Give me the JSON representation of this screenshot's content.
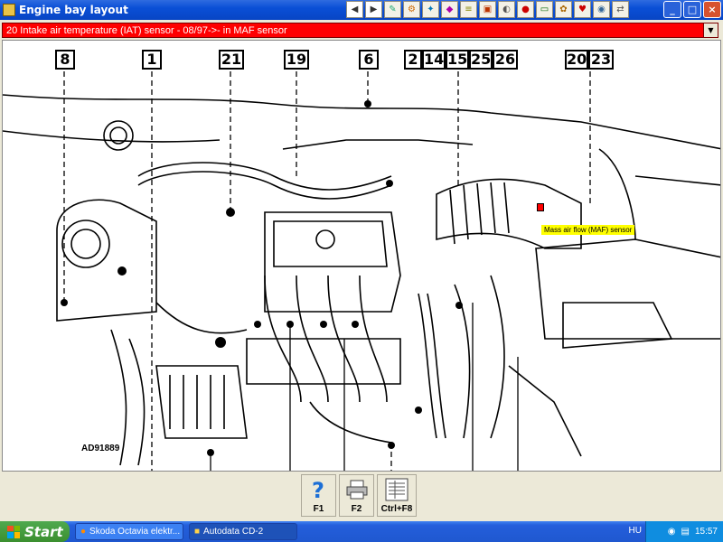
{
  "window": {
    "title": "Engine bay layout",
    "toolbar_icons": [
      "back-icon",
      "forward-icon",
      "notes-icon",
      "wiring-icon",
      "service-icon",
      "diagnostics-icon",
      "camshaft-icon",
      "brakes-icon",
      "repair-times-icon",
      "tyres-icon",
      "battery-icon",
      "settings-icon",
      "print-icon",
      "info-icon",
      "transfer-icon"
    ],
    "controls": {
      "minimize": "_",
      "maximize": "□",
      "close": "×"
    }
  },
  "selector": {
    "value": "20  Intake air temperature (IAT) sensor - 08/97->- in MAF sensor"
  },
  "diagram": {
    "callouts": [
      "8",
      "1",
      "21",
      "19",
      "6",
      "2",
      "14",
      "15",
      "25",
      "26",
      "20",
      "23"
    ],
    "highlight_label": "Mass air flow (MAF) sensor",
    "reference_code": "AD91889",
    "highlight_color": "#ffff00",
    "marker_color": "#ff0000"
  },
  "keys": [
    {
      "label": "F1",
      "icon": "help-icon"
    },
    {
      "label": "F2",
      "icon": "print-icon"
    },
    {
      "label": "Ctrl+F8",
      "icon": "list-icon"
    }
  ],
  "taskbar": {
    "start_label": "Start",
    "tasks": [
      {
        "label": "Skoda Octavia elektr...",
        "icon": "browser-icon"
      },
      {
        "label": "Autodata CD-2",
        "icon": "app-icon"
      }
    ],
    "language": "HU",
    "clock": "15:57"
  }
}
